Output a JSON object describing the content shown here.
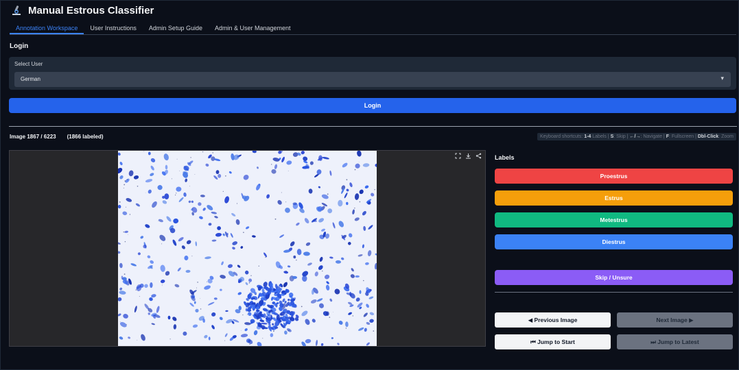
{
  "app": {
    "title": "Manual Estrous Classifier",
    "logo_icon": "microscope-icon"
  },
  "tabs": [
    {
      "label": "Annotation Workspace",
      "active": true
    },
    {
      "label": "User Instructions",
      "active": false
    },
    {
      "label": "Admin Setup Guide",
      "active": false
    },
    {
      "label": "Admin & User Management",
      "active": false
    }
  ],
  "login": {
    "section_title": "Login",
    "select_label": "Select User",
    "selected_user": "German",
    "button_label": "Login"
  },
  "image_info": {
    "counter": "Image 1867 / 6223",
    "labeled": "(1866 labeled)"
  },
  "shortcuts": {
    "prefix": "Keyboard shortcuts: ",
    "k1": "1-4",
    "t1": " Labels | ",
    "k2": "S",
    "t2": ": Skip | ",
    "k3": "←/→",
    "t3": ": Navigate | ",
    "k4": "F",
    "t4": ": Fullscreen | ",
    "k5": "Dbl-Click",
    "t5": ": Zoom"
  },
  "viewer": {
    "tools": [
      "fullscreen-icon",
      "download-icon",
      "share-icon"
    ]
  },
  "labels": {
    "title": "Labels",
    "buttons": [
      {
        "label": "Proestrus",
        "color": "#ef4444"
      },
      {
        "label": "Estrus",
        "color": "#f59e0b"
      },
      {
        "label": "Metestrus",
        "color": "#10b981"
      },
      {
        "label": "Diestrus",
        "color": "#3b82f6"
      }
    ],
    "skip": {
      "label": "Skip / Unsure",
      "color": "#8b5cf6"
    }
  },
  "navigation": {
    "prev": "◀ Previous Image",
    "next": "Next Image ▶",
    "start": "⏮ Jump to Start",
    "latest": "⏭ Jump to Latest"
  }
}
